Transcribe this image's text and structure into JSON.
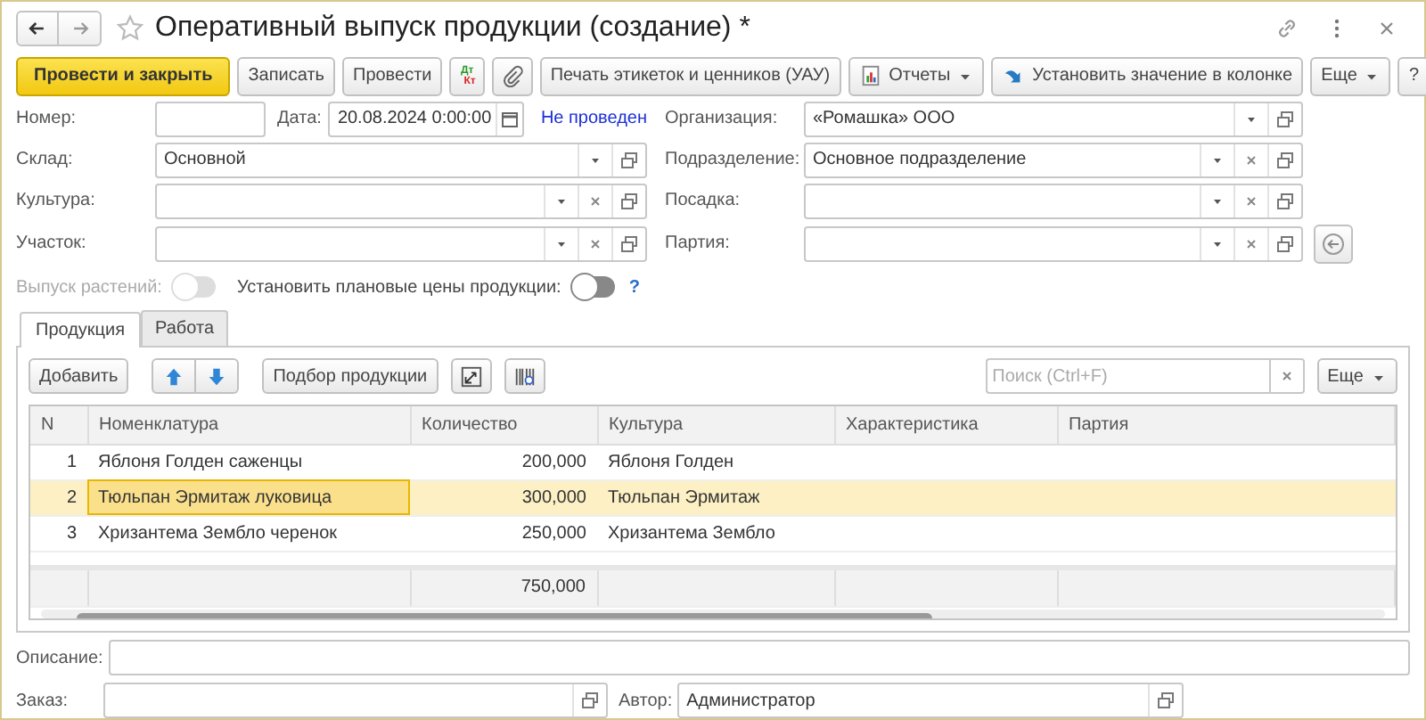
{
  "window": {
    "title": "Оперативный выпуск продукции (создание) *"
  },
  "toolbar": [
    {
      "kind": "primary",
      "label": "Провести и закрыть"
    },
    {
      "kind": "plain",
      "label": "Записать"
    },
    {
      "kind": "plain",
      "label": "Провести"
    },
    {
      "kind": "debit-credit",
      "icon_text": [
        "Дт",
        "Кт"
      ]
    },
    {
      "kind": "attach"
    },
    {
      "kind": "plain",
      "label": "Печать этикеток и ценников (УАУ)"
    },
    {
      "kind": "reports",
      "label": "Отчеты"
    },
    {
      "kind": "set-value",
      "label": "Установить значение в колонке"
    },
    {
      "kind": "more",
      "label": "Еще"
    },
    {
      "kind": "plain",
      "label": "?"
    }
  ],
  "header": {
    "number": {
      "label": "Номер:"
    },
    "date": {
      "label": "Дата:",
      "value": "20.08.2024  0:00:00"
    },
    "status": "Не проведен"
  },
  "left_fields": [
    {
      "label": "Склад:",
      "value": "Основной",
      "clearable": false
    },
    {
      "label": "Культура:",
      "clearable": true
    },
    {
      "label": "Участок:",
      "clearable": true
    }
  ],
  "right_fields": [
    {
      "label": "Организация:",
      "value": "«Ромашка» ООО",
      "clearable": false
    },
    {
      "label": "Подразделение:",
      "value": "Основное подразделение",
      "clearable": true
    },
    {
      "label": "Посадка:",
      "clearable": true
    },
    {
      "label": "Партия:",
      "clearable": true,
      "side_button": true
    }
  ],
  "toggles": [
    {
      "label": "Выпуск растений:",
      "on": false,
      "disabled": true
    },
    {
      "label": "Установить плановые цены продукции:",
      "on": false,
      "disabled": false,
      "help": "?"
    }
  ],
  "tabs": [
    {
      "label": "Продукция",
      "selected": true
    },
    {
      "label": "Работа",
      "selected": false
    }
  ],
  "table_toolbar": {
    "buttons": [
      {
        "kind": "plain",
        "label": "Добавить"
      },
      {
        "kind": "move-pair"
      },
      {
        "kind": "plain",
        "label": "Подбор продукции"
      },
      {
        "kind": "resize"
      },
      {
        "kind": "barcode"
      }
    ],
    "search": {
      "placeholder": "Поиск (Ctrl+F)"
    },
    "more": {
      "label": "Еще"
    }
  },
  "table": {
    "columns": [
      "N",
      "Номенклатура",
      "Количество",
      "Культура",
      "Характеристика",
      "Партия"
    ],
    "rows": [
      {
        "selected": false,
        "cells": [
          {
            "text": "1",
            "current": false
          },
          {
            "text": "Яблоня Голден саженцы",
            "current": false
          },
          {
            "text": "200,000",
            "current": false
          },
          {
            "text": "Яблоня Голден",
            "current": false
          }
        ]
      },
      {
        "selected": true,
        "cells": [
          {
            "text": "2",
            "current": false
          },
          {
            "text": "Тюльпан Эрмитаж луковица",
            "current": true
          },
          {
            "text": "300,000",
            "current": false
          },
          {
            "text": "Тюльпан Эрмитаж",
            "current": false
          }
        ]
      },
      {
        "selected": false,
        "cells": [
          {
            "text": "3",
            "current": false
          },
          {
            "text": "Хризантема Зембло черенок",
            "current": false
          },
          {
            "text": "250,000",
            "current": false
          },
          {
            "text": "Хризантема Зембло",
            "current": false
          }
        ]
      }
    ],
    "total_quantity": "750,000"
  },
  "description": {
    "label": "Описание:"
  },
  "order": {
    "label": "Заказ:"
  },
  "author": {
    "label": "Автор:",
    "value": "Администратор"
  }
}
